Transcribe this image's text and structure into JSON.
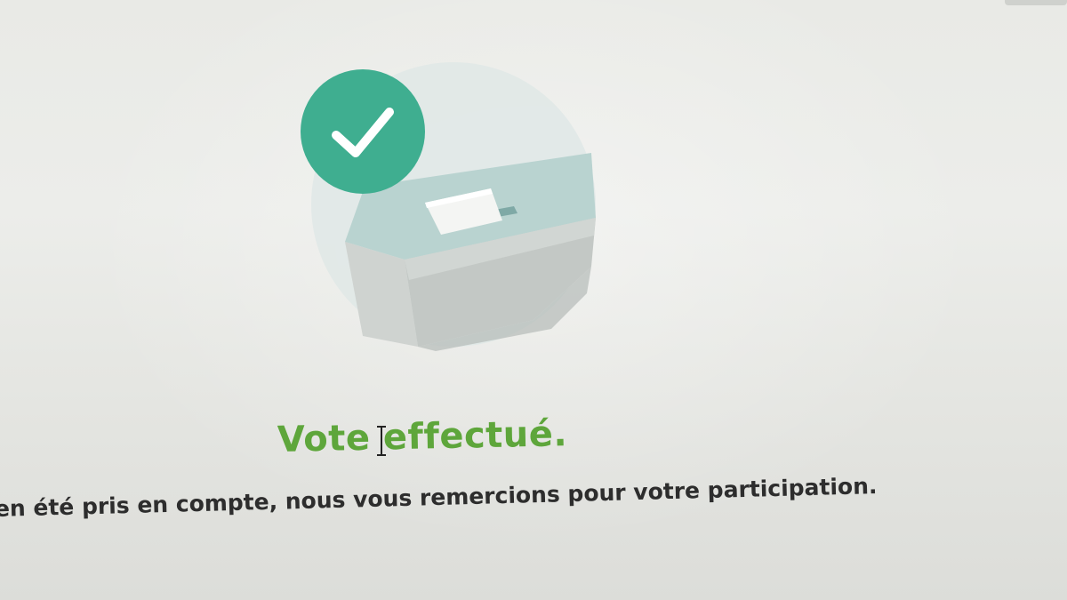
{
  "confirmation": {
    "title": "Vote effectué.",
    "message": "en été pris en compte, nous vous remercions pour votre participation."
  },
  "icons": {
    "success": "check-circle-icon",
    "illustration": "ballot-box-icon",
    "cursor": "text-cursor-icon"
  },
  "colors": {
    "accent_green": "#5ea63b",
    "check_badge": "#3fae90",
    "text": "#2d2d2d"
  }
}
